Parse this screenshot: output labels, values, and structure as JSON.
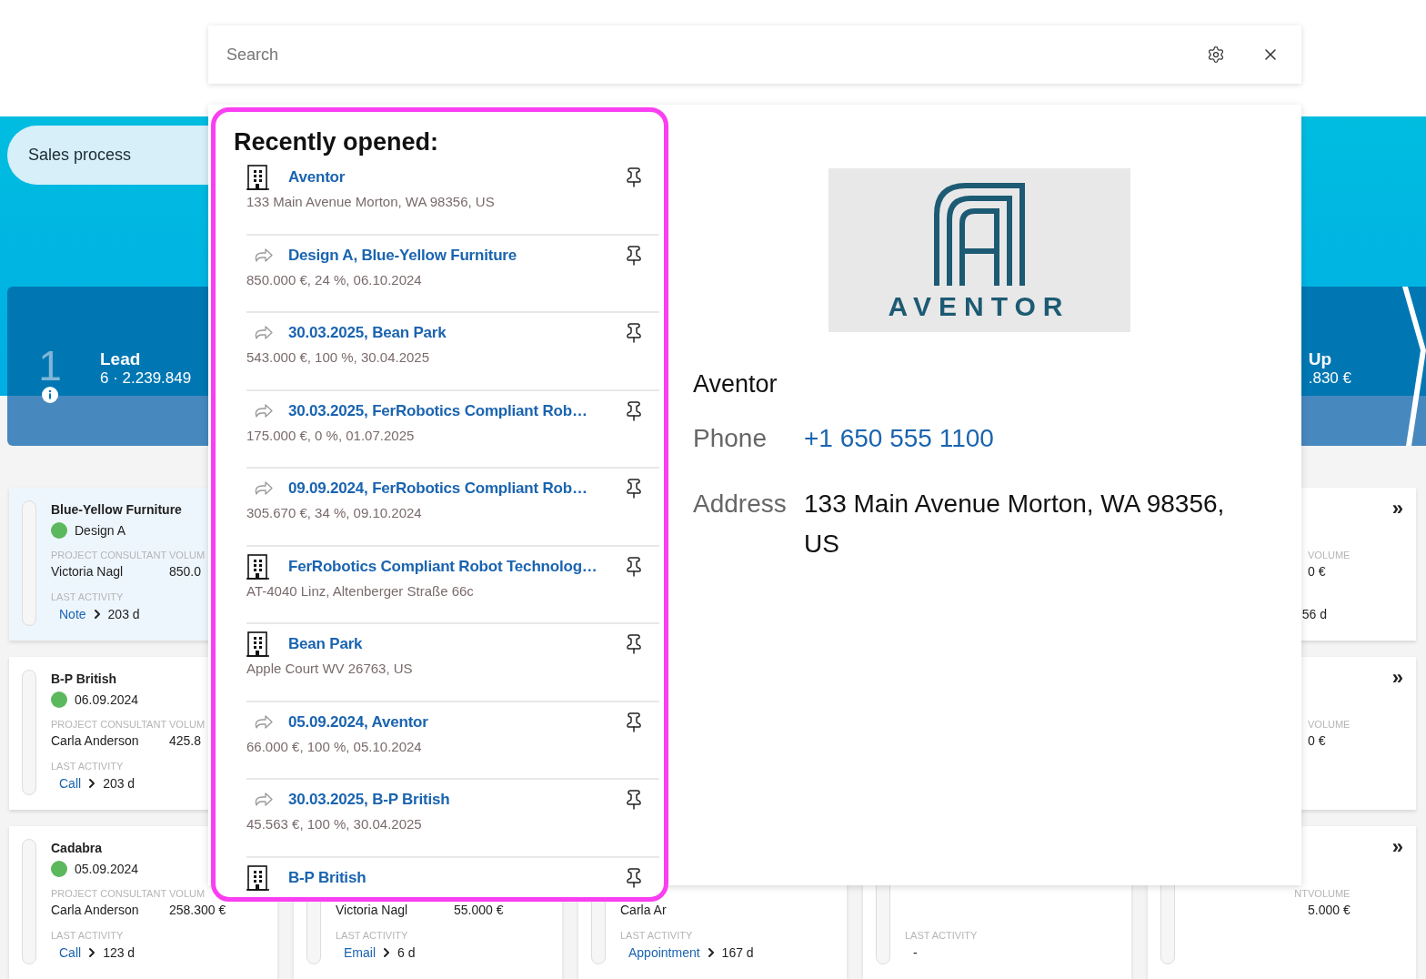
{
  "header": {
    "title": "Sales process"
  },
  "stages": [
    {
      "number": "1",
      "name": "Lead",
      "summary": "6 · 2.239.849"
    },
    {
      "name": "Up",
      "summary": ".830 €"
    }
  ],
  "board": {
    "columns": [
      {
        "cards": [
          {
            "selected": true,
            "title": "Blue-Yellow Furniture",
            "status": {
              "text": "Design A",
              "color": "#5cb85c"
            },
            "consultant_label": "PROJECT CONSULTANT",
            "volume_label": "VOLUM",
            "consultant": "Victoria Nagl",
            "volume": "850.0",
            "activity_label": "LAST ACTIVITY",
            "activity_type": "Note",
            "activity_age": "203 d"
          },
          {
            "selected": false,
            "title": "B-P British",
            "status": {
              "text": "06.09.2024",
              "color": "#5cb85c"
            },
            "consultant_label": "PROJECT CONSULTANT",
            "volume_label": "VOLUM",
            "consultant": "Carla Anderson",
            "volume": "425.8",
            "activity_label": "LAST ACTIVITY",
            "activity_type": "Call",
            "activity_age": "203 d"
          },
          {
            "selected": false,
            "title": "Cadabra",
            "status": {
              "text": "05.09.2024",
              "color": "#5cb85c"
            },
            "consultant_label": "PROJECT CONSULTANT",
            "volume_label": "VOLUM",
            "consultant": "Carla Anderson",
            "volume": "258.300 €",
            "activity_label": "LAST ACTIVITY",
            "activity_type": "Call",
            "activity_age": "123 d"
          }
        ]
      },
      {
        "cards": [
          {
            "selected": false,
            "consultant": "Victoria Nagl",
            "volume": "55.000 €",
            "activity_label": "LAST ACTIVITY",
            "activity_type": "Email",
            "activity_age": "6 d"
          }
        ]
      },
      {
        "cards": [
          {
            "selected": false,
            "consultant": "Carla Ar",
            "activity_label": "LAST ACTIVITY",
            "activity_type": "Appointment",
            "activity_age": "167 d"
          }
        ]
      },
      {
        "cards": [
          {
            "selected": false,
            "activity_label": "LAST ACTIVITY",
            "activity_age": "-"
          }
        ]
      },
      {
        "cards": [
          {
            "selected": false,
            "expand": "»",
            "volume_label": "VOLUME",
            "volume": "0 €",
            "activity_age": "56 d"
          },
          {
            "selected": false,
            "expand": "»",
            "volume_label": "VOLUME",
            "volume": "0 €"
          },
          {
            "selected": false,
            "expand": "»",
            "consultant_label": "NT",
            "volume_label": "VOLUME",
            "volume": "5.000 €"
          }
        ]
      }
    ]
  },
  "search": {
    "placeholder": "Search"
  },
  "recent": {
    "heading": "Recently opened:",
    "items": [
      {
        "kind": "account",
        "title": "Aventor",
        "subtitle": "133 Main Avenue Morton, WA 98356, US"
      },
      {
        "kind": "opportunity",
        "title": "Design A, Blue-Yellow Furniture",
        "subtitle": "850.000 €, 24 %, 06.10.2024"
      },
      {
        "kind": "opportunity",
        "title": "30.03.2025, Bean Park",
        "subtitle": "543.000 €, 100 %, 30.04.2025"
      },
      {
        "kind": "opportunity",
        "title": "30.03.2025, FerRobotics Compliant Rob…",
        "subtitle": "175.000 €, 0 %, 01.07.2025"
      },
      {
        "kind": "opportunity",
        "title": "09.09.2024, FerRobotics Compliant Rob…",
        "subtitle": "305.670 €, 34 %, 09.10.2024"
      },
      {
        "kind": "account",
        "title": "FerRobotics Compliant Robot Technolog…",
        "subtitle": "AT-4040 Linz, Altenberger Straße 66c"
      },
      {
        "kind": "account",
        "title": "Bean Park",
        "subtitle": "Apple Court WV 26763, US"
      },
      {
        "kind": "opportunity",
        "title": "05.09.2024, Aventor",
        "subtitle": "66.000 €, 100 %, 05.10.2024"
      },
      {
        "kind": "opportunity",
        "title": "30.03.2025, B-P British",
        "subtitle": "45.563 €, 100 %, 30.04.2025"
      },
      {
        "kind": "account",
        "title": "B-P British"
      }
    ]
  },
  "preview": {
    "logo_text": "AVENTOR",
    "title": "Aventor",
    "fields": [
      {
        "kind": "link",
        "label": "Phone",
        "value": "+1 650 555 1100"
      },
      {
        "kind": "text",
        "label": "Address",
        "value": "133 Main Avenue Morton, WA 98356, US"
      }
    ]
  }
}
